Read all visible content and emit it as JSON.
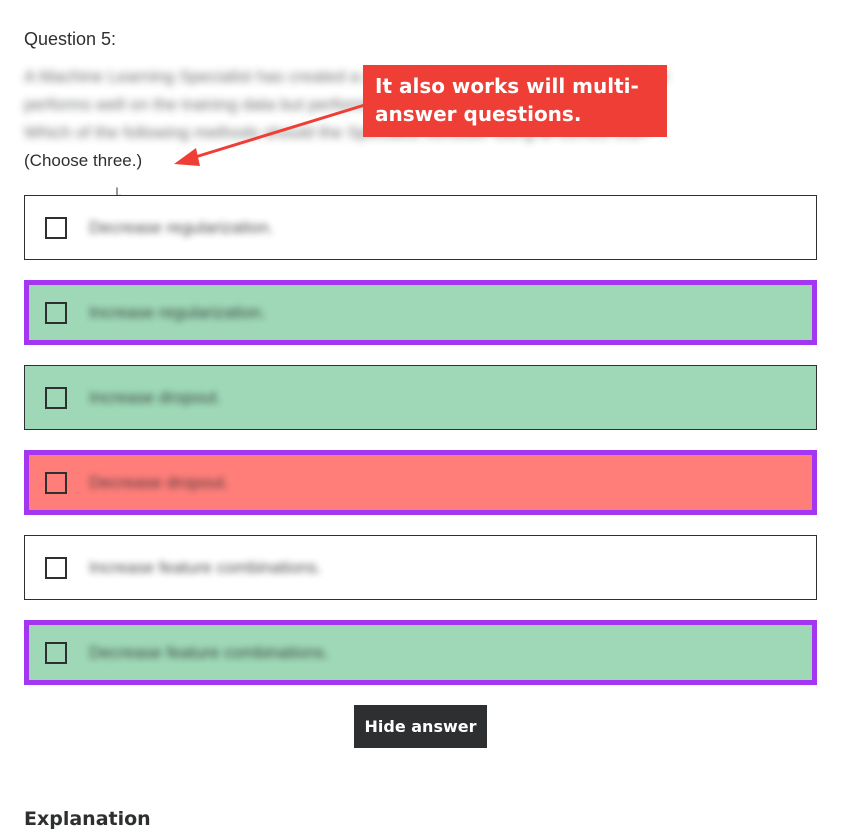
{
  "question": {
    "label": "Question 5:",
    "text_lines": [
      "A Machine Learning Specialist has created a deep learning neural network model that",
      "performs well on the training data but performs poorly on the test data.",
      "Which of the following methods should the Specialist consider using to correct this?"
    ],
    "choose_hint": "(Choose three.)"
  },
  "annotation": {
    "callout_text": "It also works will multi-answer questions.",
    "color": "#ef3e36"
  },
  "options": [
    {
      "label": "Decrease regularization.",
      "state": "neutral",
      "selected": false
    },
    {
      "label": "Increase regularization.",
      "state": "correct",
      "selected": true
    },
    {
      "label": "Increase dropout.",
      "state": "correct",
      "selected": false
    },
    {
      "label": "Decrease dropout.",
      "state": "incorrect",
      "selected": true
    },
    {
      "label": "Increase feature combinations.",
      "state": "neutral",
      "selected": false
    },
    {
      "label": "Decrease feature combinations.",
      "state": "correct",
      "selected": true
    }
  ],
  "hide_answer_label": "Hide answer",
  "explanation_heading": "Explanation",
  "colors": {
    "correct": "#9ed8b6",
    "incorrect": "#ff7e7a",
    "selected_border": "#a435f0",
    "button_bg": "#2d2f31"
  },
  "icons": {
    "cursor": "hand-pointer-icon",
    "checkbox": "checkbox-icon"
  }
}
